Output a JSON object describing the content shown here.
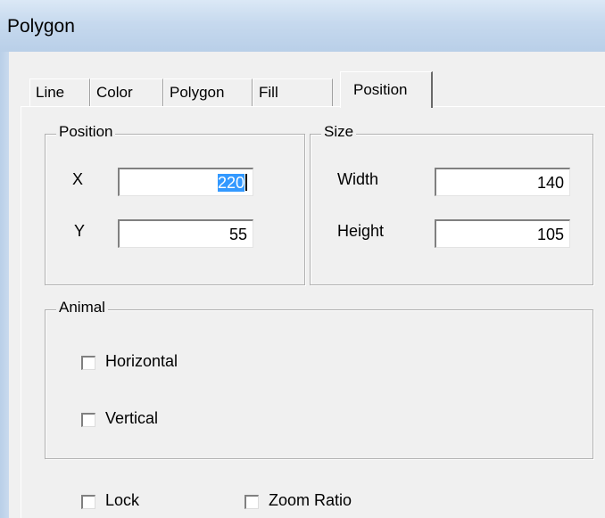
{
  "window": {
    "title": "Polygon"
  },
  "tabs": [
    {
      "label": "Line",
      "active": false
    },
    {
      "label": "Color",
      "active": false
    },
    {
      "label": "Polygon",
      "active": false
    },
    {
      "label": "Fill",
      "active": false
    },
    {
      "label": "Position",
      "active": true
    }
  ],
  "position_group": {
    "label": "Position",
    "x_label": "X",
    "x_value": "220",
    "y_label": "Y",
    "y_value": "55"
  },
  "size_group": {
    "label": "Size",
    "width_label": "Width",
    "width_value": "140",
    "height_label": "Height",
    "height_value": "105"
  },
  "animal_group": {
    "label": "Animal",
    "horizontal_label": "Horizontal",
    "horizontal_checked": false,
    "vertical_label": "Vertical",
    "vertical_checked": false
  },
  "options": {
    "lock_label": "Lock",
    "lock_checked": false,
    "zoom_ratio_label": "Zoom Ratio",
    "zoom_ratio_checked": false
  },
  "colors": {
    "selection": "#3399ff",
    "dialog_bg": "#f0f0f0",
    "titlebar": "#c6d9ee"
  }
}
